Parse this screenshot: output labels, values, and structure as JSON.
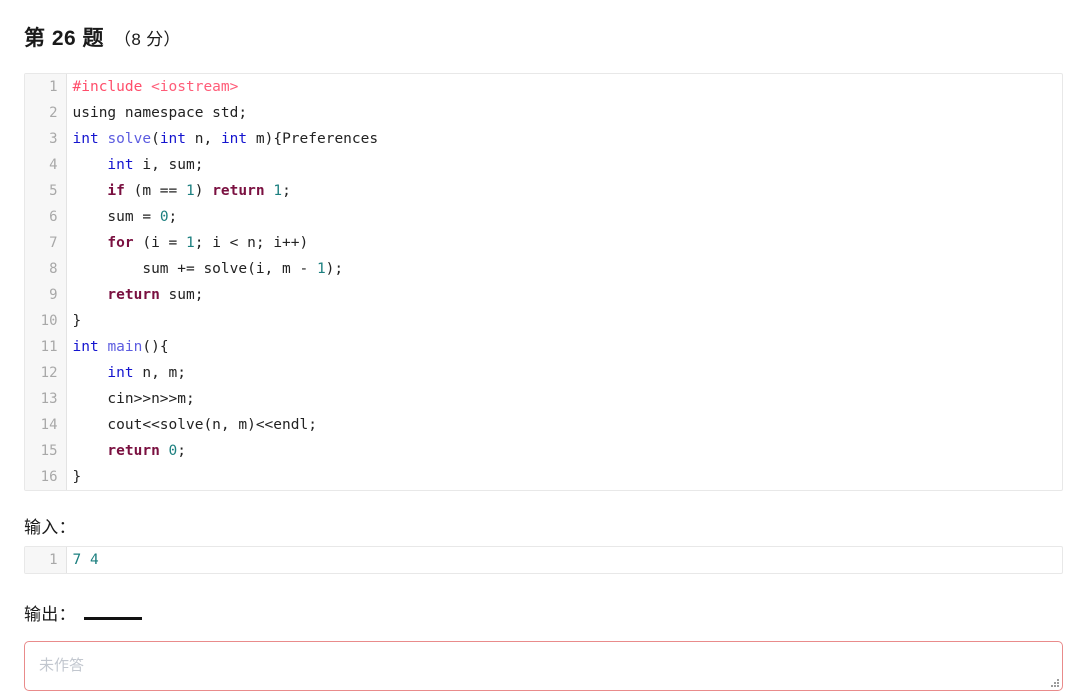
{
  "header": {
    "title": "第 26 题",
    "score": "（8 分）"
  },
  "code": {
    "language": "cpp",
    "lines": [
      {
        "no": "1",
        "tokens": [
          {
            "t": "#include ",
            "c": "pre"
          },
          {
            "t": "<iostream>",
            "c": "inc"
          }
        ]
      },
      {
        "no": "2",
        "tokens": [
          {
            "t": "using namespace std;",
            "c": "plain"
          }
        ]
      },
      {
        "no": "3",
        "tokens": [
          {
            "t": "int",
            "c": "type"
          },
          {
            "t": " ",
            "c": "plain"
          },
          {
            "t": "solve",
            "c": "fn"
          },
          {
            "t": "(",
            "c": "plain"
          },
          {
            "t": "int",
            "c": "type"
          },
          {
            "t": " n, ",
            "c": "plain"
          },
          {
            "t": "int",
            "c": "type"
          },
          {
            "t": " m){Preferences",
            "c": "plain"
          }
        ]
      },
      {
        "no": "4",
        "tokens": [
          {
            "t": "    ",
            "c": "plain"
          },
          {
            "t": "int",
            "c": "type"
          },
          {
            "t": " i, sum;",
            "c": "plain"
          }
        ]
      },
      {
        "no": "5",
        "tokens": [
          {
            "t": "    ",
            "c": "plain"
          },
          {
            "t": "if",
            "c": "kw"
          },
          {
            "t": " (m == ",
            "c": "plain"
          },
          {
            "t": "1",
            "c": "num"
          },
          {
            "t": ") ",
            "c": "plain"
          },
          {
            "t": "return",
            "c": "kw"
          },
          {
            "t": " ",
            "c": "plain"
          },
          {
            "t": "1",
            "c": "num"
          },
          {
            "t": ";",
            "c": "plain"
          }
        ]
      },
      {
        "no": "6",
        "tokens": [
          {
            "t": "    sum = ",
            "c": "plain"
          },
          {
            "t": "0",
            "c": "num"
          },
          {
            "t": ";",
            "c": "plain"
          }
        ]
      },
      {
        "no": "7",
        "tokens": [
          {
            "t": "    ",
            "c": "plain"
          },
          {
            "t": "for",
            "c": "kw"
          },
          {
            "t": " (i = ",
            "c": "plain"
          },
          {
            "t": "1",
            "c": "num"
          },
          {
            "t": "; i < n; i++)",
            "c": "plain"
          }
        ]
      },
      {
        "no": "8",
        "tokens": [
          {
            "t": "        sum += solve(i, m - ",
            "c": "plain"
          },
          {
            "t": "1",
            "c": "num"
          },
          {
            "t": ");",
            "c": "plain"
          }
        ]
      },
      {
        "no": "9",
        "tokens": [
          {
            "t": "    ",
            "c": "plain"
          },
          {
            "t": "return",
            "c": "kw"
          },
          {
            "t": " sum;",
            "c": "plain"
          }
        ]
      },
      {
        "no": "10",
        "tokens": [
          {
            "t": "}",
            "c": "plain"
          }
        ]
      },
      {
        "no": "11",
        "tokens": [
          {
            "t": "int",
            "c": "type"
          },
          {
            "t": " ",
            "c": "plain"
          },
          {
            "t": "main",
            "c": "fn"
          },
          {
            "t": "(){",
            "c": "plain"
          }
        ]
      },
      {
        "no": "12",
        "tokens": [
          {
            "t": "    ",
            "c": "plain"
          },
          {
            "t": "int",
            "c": "type"
          },
          {
            "t": " n, m;",
            "c": "plain"
          }
        ]
      },
      {
        "no": "13",
        "tokens": [
          {
            "t": "    cin>>n>>m;",
            "c": "plain"
          }
        ]
      },
      {
        "no": "14",
        "tokens": [
          {
            "t": "    cout<<solve(n, m)<<endl;",
            "c": "plain"
          }
        ]
      },
      {
        "no": "15",
        "tokens": [
          {
            "t": "    ",
            "c": "plain"
          },
          {
            "t": "return",
            "c": "kw"
          },
          {
            "t": " ",
            "c": "plain"
          },
          {
            "t": "0",
            "c": "num"
          },
          {
            "t": ";",
            "c": "plain"
          }
        ]
      },
      {
        "no": "16",
        "tokens": [
          {
            "t": "}",
            "c": "plain"
          }
        ]
      }
    ]
  },
  "input_section": {
    "label": "输入：",
    "lines": [
      {
        "no": "1",
        "tokens": [
          {
            "t": "7 4",
            "c": "num"
          }
        ]
      }
    ]
  },
  "output_section": {
    "label": "输出：",
    "blank": ""
  },
  "answer": {
    "value": "",
    "placeholder": "未作答"
  },
  "colors": {
    "preprocessor": "#ff4d6a",
    "include_path": "#ff5c78",
    "type": "#1414cf",
    "function": "#5c5ce0",
    "keyword": "#7a1040",
    "number": "#1b7f7f",
    "plain": "#222222",
    "gutter_bg": "#f7f7f7",
    "gutter_text": "#a8a8a8",
    "block_border": "#e8e8e8",
    "answer_border": "#e98b8b",
    "placeholder": "#c2c7cf"
  }
}
